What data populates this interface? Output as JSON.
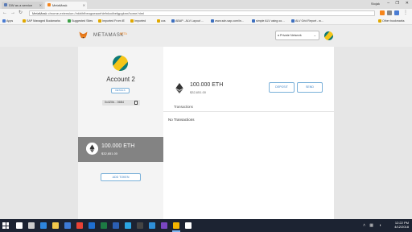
{
  "browser": {
    "tabs": [
      {
        "label": "DW as a service",
        "active": false,
        "favicon_color": "#5a7bb5"
      },
      {
        "label": "MetaMask",
        "active": true,
        "favicon_color": "#f6851b"
      }
    ],
    "window_user": "Stojak",
    "window_controls": {
      "minimize": "–",
      "maximize": "❐",
      "close": "✕"
    },
    "nav": {
      "back": "←",
      "forward": "→",
      "reload": "↻"
    },
    "address": {
      "scheme": "MetaMask",
      "url": "chrome-extension://nkbihfbeogaeaoehlefnkodbefgpgknn/home.html"
    },
    "bookmarks": [
      {
        "label": "Apps",
        "color": "#4a7cd3"
      },
      {
        "label": "SAP Managed Bookmarks",
        "color": "#e0a800"
      },
      {
        "label": "Suggested Sites",
        "color": "#3ca046"
      },
      {
        "label": "Imported From IE",
        "color": "#e0a800"
      },
      {
        "label": "Imported",
        "color": "#e0a800"
      },
      {
        "label": "cos",
        "color": "#e0a800"
      },
      {
        "label": "ABAP - ALV Layout …",
        "color": "#3d6fbf"
      },
      {
        "label": "www.sdn.sap.com/in…",
        "color": "#3d6fbf"
      },
      {
        "label": "simple ALV using oo…",
        "color": "#3d6fbf"
      },
      {
        "label": "ALV Grid Report - w…",
        "color": "#3d6fbf"
      },
      {
        "label": "Other bookmarks",
        "color": "#e0a800"
      }
    ]
  },
  "metamask": {
    "brand": "METAMASK",
    "beta": "BETA",
    "network": "Private Network",
    "network_chevron": "⌄",
    "account": {
      "name": "Account 2",
      "details_label": "DETAILS",
      "address_short": "0x4Z0b…06B4",
      "avatar_colors": [
        "#f5c518",
        "#0d7a7a"
      ]
    },
    "token_row": {
      "amount": "100.000 ETH",
      "fiat": "$32,651.00"
    },
    "add_token_label": "ADD TOKEN",
    "balance": {
      "amount": "100.000 ETH",
      "fiat": "$32,651.00"
    },
    "deposit_label": "DEPOSIT",
    "send_label": "SEND",
    "transactions_label": "Transactions",
    "no_transactions": "No Transactions"
  },
  "taskbar": {
    "icons": [
      {
        "name": "search-icon",
        "color": "#ffffff"
      },
      {
        "name": "task-view-icon",
        "color": "#cccccc"
      },
      {
        "name": "ie-icon",
        "color": "#2e86de"
      },
      {
        "name": "explorer-icon",
        "color": "#f2c94c"
      },
      {
        "name": "store-icon",
        "color": "#3d7bd6"
      },
      {
        "name": "chrome-icon",
        "color": "#e94235"
      },
      {
        "name": "outlook-icon",
        "color": "#1f6fd1"
      },
      {
        "name": "excel-icon",
        "color": "#1d7a44"
      },
      {
        "name": "word-icon",
        "color": "#2b5fb5"
      },
      {
        "name": "skype-icon",
        "color": "#2ba5e3"
      },
      {
        "name": "terminal-icon",
        "color": "#444444"
      },
      {
        "name": "vscode-icon",
        "color": "#2f8fd8"
      },
      {
        "name": "notes-icon",
        "color": "#7a47c2"
      },
      {
        "name": "chrome-active-icon",
        "color": "#f4b400"
      },
      {
        "name": "app-icon",
        "color": "#ffffff"
      }
    ],
    "time": "12:22 PM",
    "date": "4/12/2018"
  }
}
